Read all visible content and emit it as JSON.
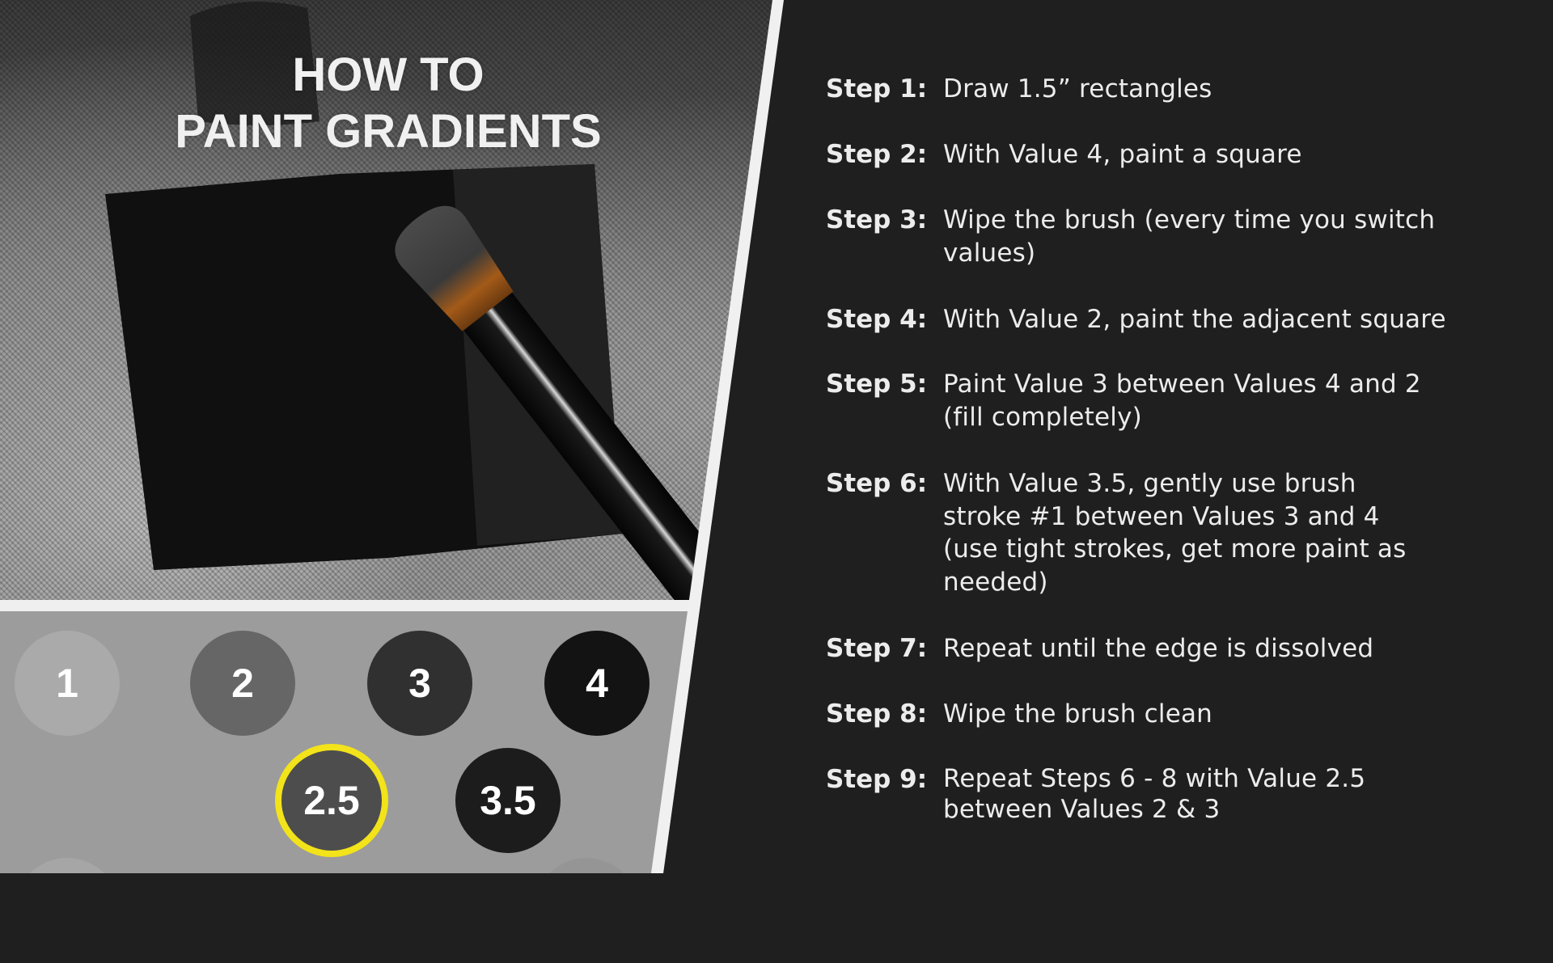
{
  "title": {
    "line1": "HOW TO",
    "line2": "PAINT GRADIENTS"
  },
  "colors": {
    "background": "#1f1f1f",
    "text": "#ececec",
    "divider": "#f0f0f0",
    "swatch_panel": "#9c9c9c",
    "highlight_ring": "#f2e31a"
  },
  "swatches": [
    {
      "label": "1",
      "color": "#aaaaaa",
      "selected": false
    },
    {
      "label": "2",
      "color": "#666666",
      "selected": false
    },
    {
      "label": "3",
      "color": "#303030",
      "selected": false
    },
    {
      "label": "4",
      "color": "#131313",
      "selected": false
    },
    {
      "label": "2.5",
      "color": "#4d4d4d",
      "selected": true
    },
    {
      "label": "3.5",
      "color": "#1c1c1c",
      "selected": false
    }
  ],
  "steps": [
    {
      "label": "Step 1:",
      "text": "Draw 1.5” rectangles"
    },
    {
      "label": "Step 2:",
      "text": "With Value 4, paint a square"
    },
    {
      "label": "Step 3:",
      "text": "Wipe the brush (every time you switch\nvalues)"
    },
    {
      "label": "Step 4:",
      "text": "With Value 2, paint the adjacent square"
    },
    {
      "label": "Step 5:",
      "text": "Paint Value 3 between Values 4 and 2\n(fill completely)"
    },
    {
      "label": "Step 6:",
      "text": "With Value 3.5, gently use brush\nstroke #1 between Values 3 and 4\n(use tight strokes, get more paint as\nneeded)"
    },
    {
      "label": "Step 7:",
      "text": "Repeat until the edge is dissolved"
    },
    {
      "label": "Step 8:",
      "text": "Wipe the brush clean"
    },
    {
      "label": "Step 9:",
      "text": "Repeat Steps 6 - 8 with Value 2.5\nbetween Values 2 & 3"
    }
  ]
}
